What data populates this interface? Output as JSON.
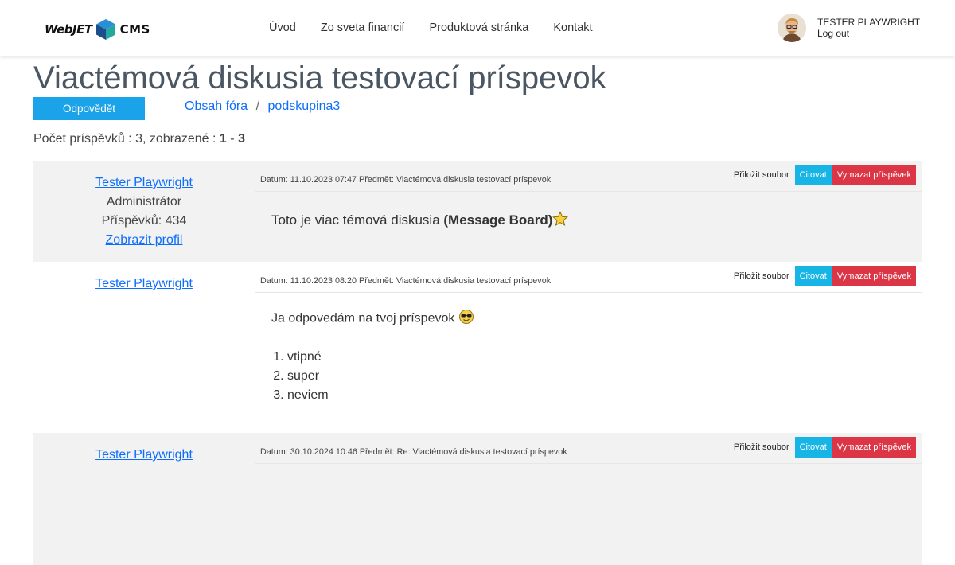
{
  "header": {
    "logo": {
      "part1": "WebJET",
      "part2": "CMS"
    },
    "nav": [
      "Úvod",
      "Zo sveta financií",
      "Produktová stránka",
      "Kontakt"
    ],
    "user": {
      "name": "TESTER PLAYWRIGHT",
      "logout": "Log out"
    }
  },
  "page": {
    "title": "Viactémová diskusia testovací príspevok",
    "reply_button": "Odpovědět",
    "breadcrumb": {
      "forum": "Obsah fóra",
      "separator": "/",
      "group": "podskupina3"
    },
    "count": {
      "prefix": "Počet príspěvků : 3, zobrazené :",
      "from": "1",
      "dash": "-",
      "to": "3"
    }
  },
  "buttons": {
    "attach": "Přiložit soubor",
    "quote": "Citovat",
    "delete": "Vymazat příspěvek"
  },
  "posts": [
    {
      "author": "Tester Playwright",
      "role": "Administrátor",
      "post_count": "Příspěvků: 434",
      "profile_link": "Zobrazit profil",
      "meta": "Datum: 11.10.2023 07:47 Předmět: Viactémová diskusia testovací príspevok",
      "text": "Toto je viac témová diskusia",
      "bold": "(Message Board)",
      "emoji": "star-emoji"
    },
    {
      "author": "Tester Playwright",
      "meta": "Datum: 11.10.2023 08:20 Předmět: Viactémová diskusia testovací príspevok",
      "text": "Ja odpovedám na tvoj príspevok",
      "emoji": "sunglasses-emoji",
      "list": [
        "vtipné",
        "super",
        "neviem"
      ]
    },
    {
      "author": "Tester Playwright",
      "meta": "Datum: 30.10.2024 10:46 Předmět: Re: Viactémová diskusia testovací príspevok"
    }
  ]
}
